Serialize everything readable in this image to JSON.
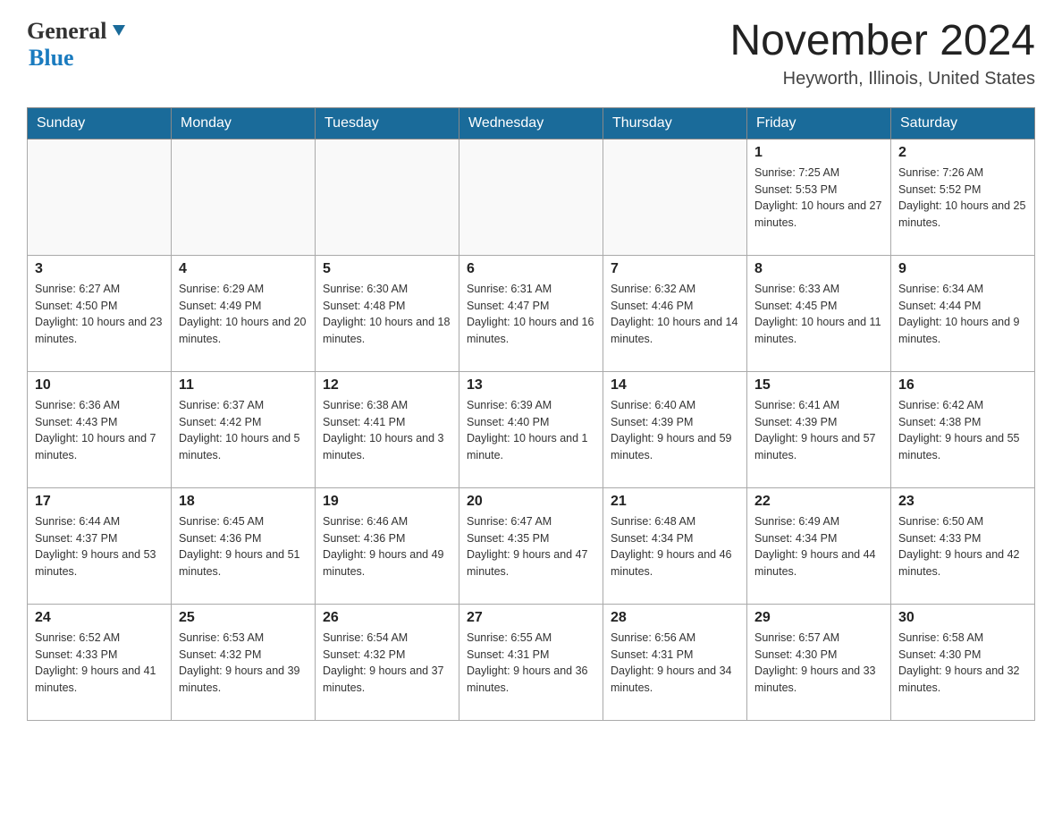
{
  "header": {
    "logo": {
      "general_text": "General",
      "blue_text": "Blue"
    },
    "title": "November 2024",
    "location": "Heyworth, Illinois, United States"
  },
  "weekdays": [
    "Sunday",
    "Monday",
    "Tuesday",
    "Wednesday",
    "Thursday",
    "Friday",
    "Saturday"
  ],
  "weeks": [
    [
      {
        "day": "",
        "sunrise": "",
        "sunset": "",
        "daylight": ""
      },
      {
        "day": "",
        "sunrise": "",
        "sunset": "",
        "daylight": ""
      },
      {
        "day": "",
        "sunrise": "",
        "sunset": "",
        "daylight": ""
      },
      {
        "day": "",
        "sunrise": "",
        "sunset": "",
        "daylight": ""
      },
      {
        "day": "",
        "sunrise": "",
        "sunset": "",
        "daylight": ""
      },
      {
        "day": "1",
        "sunrise": "Sunrise: 7:25 AM",
        "sunset": "Sunset: 5:53 PM",
        "daylight": "Daylight: 10 hours and 27 minutes."
      },
      {
        "day": "2",
        "sunrise": "Sunrise: 7:26 AM",
        "sunset": "Sunset: 5:52 PM",
        "daylight": "Daylight: 10 hours and 25 minutes."
      }
    ],
    [
      {
        "day": "3",
        "sunrise": "Sunrise: 6:27 AM",
        "sunset": "Sunset: 4:50 PM",
        "daylight": "Daylight: 10 hours and 23 minutes."
      },
      {
        "day": "4",
        "sunrise": "Sunrise: 6:29 AM",
        "sunset": "Sunset: 4:49 PM",
        "daylight": "Daylight: 10 hours and 20 minutes."
      },
      {
        "day": "5",
        "sunrise": "Sunrise: 6:30 AM",
        "sunset": "Sunset: 4:48 PM",
        "daylight": "Daylight: 10 hours and 18 minutes."
      },
      {
        "day": "6",
        "sunrise": "Sunrise: 6:31 AM",
        "sunset": "Sunset: 4:47 PM",
        "daylight": "Daylight: 10 hours and 16 minutes."
      },
      {
        "day": "7",
        "sunrise": "Sunrise: 6:32 AM",
        "sunset": "Sunset: 4:46 PM",
        "daylight": "Daylight: 10 hours and 14 minutes."
      },
      {
        "day": "8",
        "sunrise": "Sunrise: 6:33 AM",
        "sunset": "Sunset: 4:45 PM",
        "daylight": "Daylight: 10 hours and 11 minutes."
      },
      {
        "day": "9",
        "sunrise": "Sunrise: 6:34 AM",
        "sunset": "Sunset: 4:44 PM",
        "daylight": "Daylight: 10 hours and 9 minutes."
      }
    ],
    [
      {
        "day": "10",
        "sunrise": "Sunrise: 6:36 AM",
        "sunset": "Sunset: 4:43 PM",
        "daylight": "Daylight: 10 hours and 7 minutes."
      },
      {
        "day": "11",
        "sunrise": "Sunrise: 6:37 AM",
        "sunset": "Sunset: 4:42 PM",
        "daylight": "Daylight: 10 hours and 5 minutes."
      },
      {
        "day": "12",
        "sunrise": "Sunrise: 6:38 AM",
        "sunset": "Sunset: 4:41 PM",
        "daylight": "Daylight: 10 hours and 3 minutes."
      },
      {
        "day": "13",
        "sunrise": "Sunrise: 6:39 AM",
        "sunset": "Sunset: 4:40 PM",
        "daylight": "Daylight: 10 hours and 1 minute."
      },
      {
        "day": "14",
        "sunrise": "Sunrise: 6:40 AM",
        "sunset": "Sunset: 4:39 PM",
        "daylight": "Daylight: 9 hours and 59 minutes."
      },
      {
        "day": "15",
        "sunrise": "Sunrise: 6:41 AM",
        "sunset": "Sunset: 4:39 PM",
        "daylight": "Daylight: 9 hours and 57 minutes."
      },
      {
        "day": "16",
        "sunrise": "Sunrise: 6:42 AM",
        "sunset": "Sunset: 4:38 PM",
        "daylight": "Daylight: 9 hours and 55 minutes."
      }
    ],
    [
      {
        "day": "17",
        "sunrise": "Sunrise: 6:44 AM",
        "sunset": "Sunset: 4:37 PM",
        "daylight": "Daylight: 9 hours and 53 minutes."
      },
      {
        "day": "18",
        "sunrise": "Sunrise: 6:45 AM",
        "sunset": "Sunset: 4:36 PM",
        "daylight": "Daylight: 9 hours and 51 minutes."
      },
      {
        "day": "19",
        "sunrise": "Sunrise: 6:46 AM",
        "sunset": "Sunset: 4:36 PM",
        "daylight": "Daylight: 9 hours and 49 minutes."
      },
      {
        "day": "20",
        "sunrise": "Sunrise: 6:47 AM",
        "sunset": "Sunset: 4:35 PM",
        "daylight": "Daylight: 9 hours and 47 minutes."
      },
      {
        "day": "21",
        "sunrise": "Sunrise: 6:48 AM",
        "sunset": "Sunset: 4:34 PM",
        "daylight": "Daylight: 9 hours and 46 minutes."
      },
      {
        "day": "22",
        "sunrise": "Sunrise: 6:49 AM",
        "sunset": "Sunset: 4:34 PM",
        "daylight": "Daylight: 9 hours and 44 minutes."
      },
      {
        "day": "23",
        "sunrise": "Sunrise: 6:50 AM",
        "sunset": "Sunset: 4:33 PM",
        "daylight": "Daylight: 9 hours and 42 minutes."
      }
    ],
    [
      {
        "day": "24",
        "sunrise": "Sunrise: 6:52 AM",
        "sunset": "Sunset: 4:33 PM",
        "daylight": "Daylight: 9 hours and 41 minutes."
      },
      {
        "day": "25",
        "sunrise": "Sunrise: 6:53 AM",
        "sunset": "Sunset: 4:32 PM",
        "daylight": "Daylight: 9 hours and 39 minutes."
      },
      {
        "day": "26",
        "sunrise": "Sunrise: 6:54 AM",
        "sunset": "Sunset: 4:32 PM",
        "daylight": "Daylight: 9 hours and 37 minutes."
      },
      {
        "day": "27",
        "sunrise": "Sunrise: 6:55 AM",
        "sunset": "Sunset: 4:31 PM",
        "daylight": "Daylight: 9 hours and 36 minutes."
      },
      {
        "day": "28",
        "sunrise": "Sunrise: 6:56 AM",
        "sunset": "Sunset: 4:31 PM",
        "daylight": "Daylight: 9 hours and 34 minutes."
      },
      {
        "day": "29",
        "sunrise": "Sunrise: 6:57 AM",
        "sunset": "Sunset: 4:30 PM",
        "daylight": "Daylight: 9 hours and 33 minutes."
      },
      {
        "day": "30",
        "sunrise": "Sunrise: 6:58 AM",
        "sunset": "Sunset: 4:30 PM",
        "daylight": "Daylight: 9 hours and 32 minutes."
      }
    ]
  ]
}
